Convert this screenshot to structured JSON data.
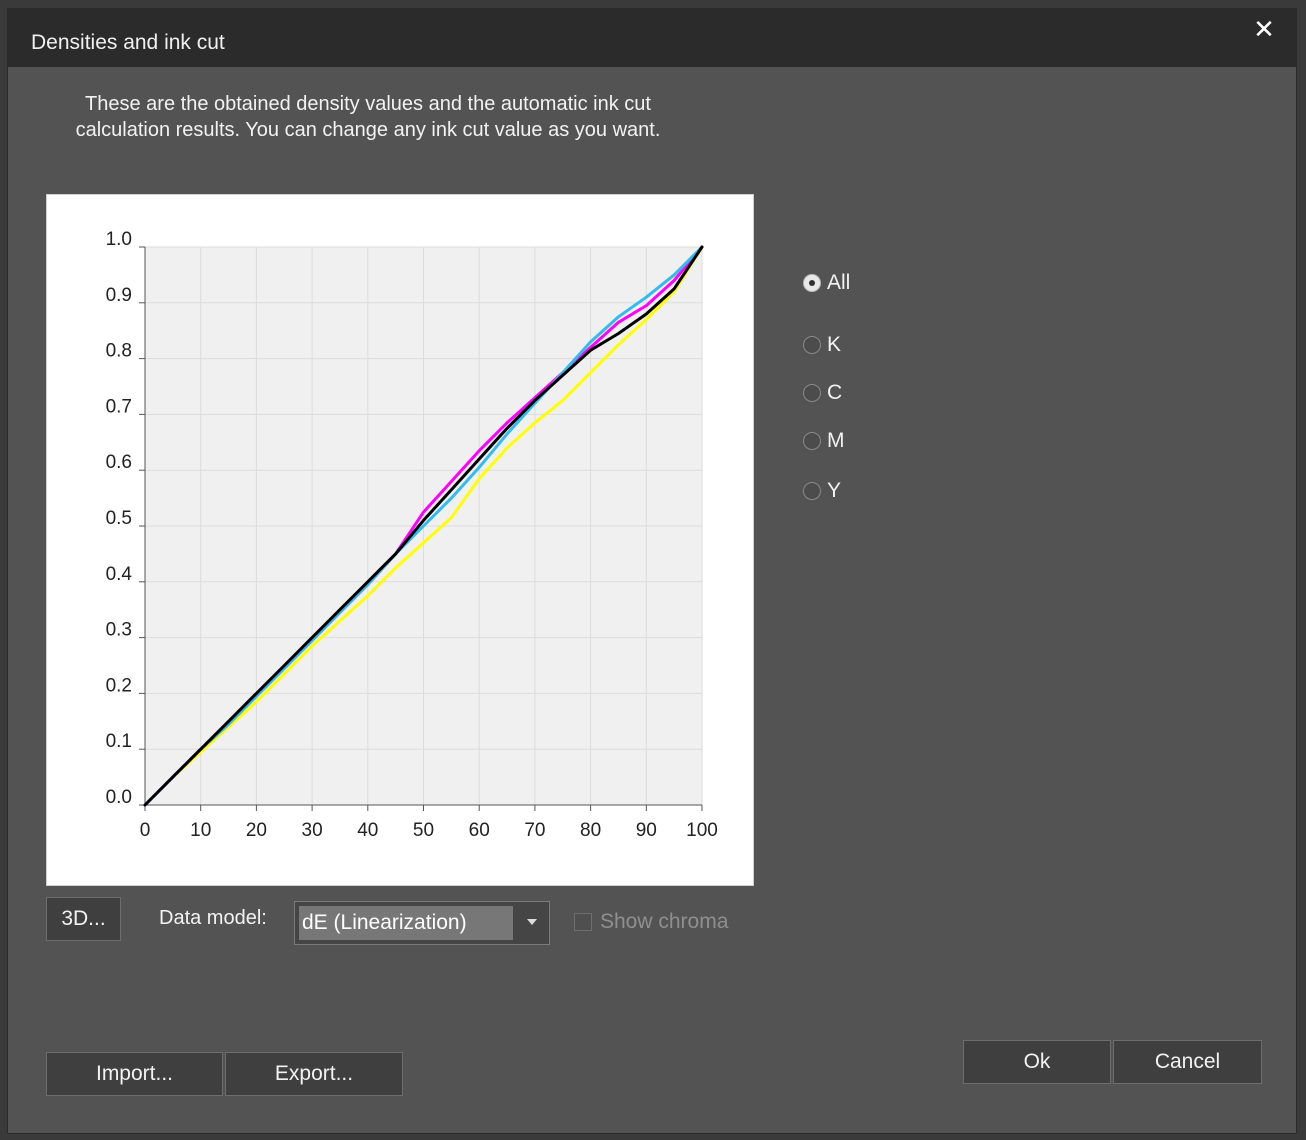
{
  "window": {
    "title": "Densities and ink cut",
    "close_glyph": "✕"
  },
  "description": "These are the obtained density values and the automatic ink cut calculation results. You can change any ink cut value as you want.",
  "channel_options": [
    {
      "label": "All",
      "checked": true
    },
    {
      "label": "K",
      "checked": false
    },
    {
      "label": "C",
      "checked": false
    },
    {
      "label": "M",
      "checked": false
    },
    {
      "label": "Y",
      "checked": false
    }
  ],
  "controls": {
    "three_d_label": "3D...",
    "data_model_label": "Data model:",
    "data_model_value": "dE (Linearization)",
    "show_chroma_label": "Show chroma",
    "show_chroma_checked": false
  },
  "footer": {
    "import_label": "Import...",
    "export_label": "Export...",
    "ok_label": "Ok",
    "cancel_label": "Cancel"
  },
  "chart_data": {
    "type": "line",
    "title": "",
    "xlabel": "",
    "ylabel": "",
    "xlim": [
      0,
      100
    ],
    "ylim": [
      0,
      1
    ],
    "grid": true,
    "x_ticks": [
      "0",
      "10",
      "20",
      "30",
      "40",
      "50",
      "60",
      "70",
      "80",
      "90",
      "100"
    ],
    "y_ticks": [
      "0.0",
      "0.1",
      "0.2",
      "0.3",
      "0.4",
      "0.5",
      "0.6",
      "0.7",
      "0.8",
      "0.9",
      "1.0"
    ],
    "x": [
      0,
      5,
      10,
      15,
      20,
      25,
      30,
      35,
      40,
      45,
      50,
      55,
      60,
      65,
      70,
      75,
      80,
      85,
      90,
      95,
      100
    ],
    "series": [
      {
        "color": "#ffff00",
        "values": [
          0,
          0.05,
          0.095,
          0.14,
          0.185,
          0.235,
          0.285,
          0.33,
          0.375,
          0.425,
          0.47,
          0.515,
          0.585,
          0.64,
          0.685,
          0.725,
          0.775,
          0.825,
          0.87,
          0.92,
          1.0
        ]
      },
      {
        "color": "#ff00ff",
        "values": [
          0,
          0.05,
          0.1,
          0.145,
          0.195,
          0.245,
          0.295,
          0.345,
          0.395,
          0.45,
          0.525,
          0.58,
          0.635,
          0.685,
          0.73,
          0.775,
          0.82,
          0.865,
          0.895,
          0.94,
          1.0
        ]
      },
      {
        "color": "#33bbee",
        "values": [
          0,
          0.05,
          0.1,
          0.145,
          0.195,
          0.245,
          0.295,
          0.345,
          0.395,
          0.45,
          0.5,
          0.55,
          0.605,
          0.665,
          0.72,
          0.775,
          0.83,
          0.875,
          0.91,
          0.95,
          1.0
        ]
      },
      {
        "color": "#000000",
        "values": [
          0,
          0.05,
          0.1,
          0.15,
          0.2,
          0.25,
          0.3,
          0.35,
          0.4,
          0.45,
          0.51,
          0.565,
          0.62,
          0.675,
          0.725,
          0.77,
          0.815,
          0.845,
          0.88,
          0.925,
          1.0
        ]
      }
    ]
  }
}
